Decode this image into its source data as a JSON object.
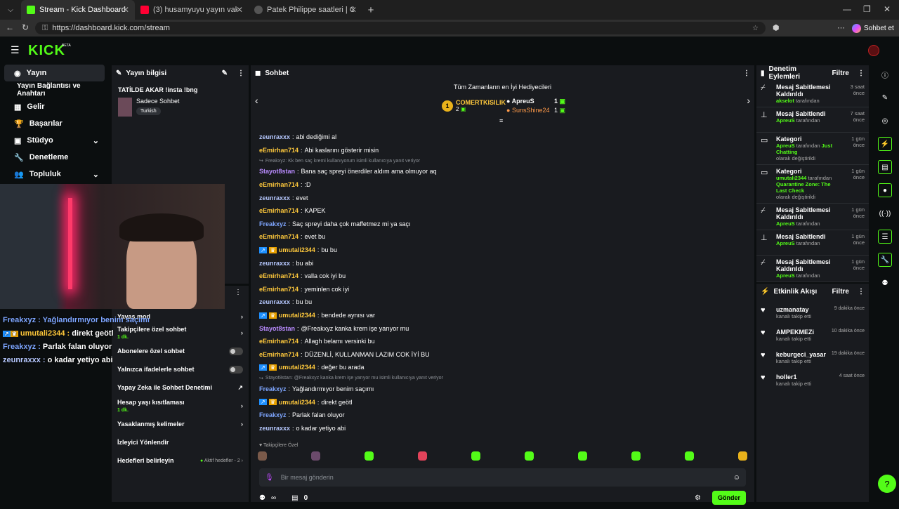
{
  "browser": {
    "tabs": [
      {
        "title": "Stream - Kick Dashboard",
        "active": true
      },
      {
        "title": "(3) husamyuyu yayın vakti 14 - You",
        "active": false
      },
      {
        "title": "Patek Philippe saatleri | Chrono24",
        "active": false
      }
    ],
    "url": "https://dashboard.kick.com/stream",
    "profile_label": "Sohbet et"
  },
  "brand": {
    "logo": "KICK",
    "beta": "BETA",
    "accent": "#53fc18"
  },
  "sidebar": {
    "items": [
      {
        "label": "Yayın",
        "icon": "broadcast-icon"
      },
      {
        "label": "Yayın Bağlantısı ve Anahtarı",
        "icon": ""
      },
      {
        "label": "Gelir",
        "icon": "money-icon"
      },
      {
        "label": "Başarılar",
        "icon": "trophy-icon"
      },
      {
        "label": "Stüdyo",
        "icon": "studio-icon"
      },
      {
        "label": "Denetleme",
        "icon": "wrench-icon"
      },
      {
        "label": "Topluluk",
        "icon": "community-icon"
      }
    ]
  },
  "stream_info": {
    "header": "Yayın bilgisi",
    "title": "TATİLDE AKAR !insta !bng",
    "category": "Sadece Sohbet",
    "tag": "Turkish"
  },
  "overlay_chat": [
    {
      "user": "Freakxyz",
      "text": "Yağlandırmıyor benim saçımı",
      "color": "#7ea6ff"
    },
    {
      "user": "umutali2344",
      "text": "direkt geötl",
      "color": "#ffc93c"
    },
    {
      "user": "Freakxyz",
      "text": "Parlak falan oluyor",
      "color": "#7ea6ff"
    },
    {
      "user": "zeunraxxx",
      "text": "o kadar yetiyo abi",
      "color": "#b6c8ff"
    }
  ],
  "chat_settings": {
    "rows": [
      {
        "label": "Yavaş mod",
        "sub": "",
        "control": "chevron"
      },
      {
        "label": "Takipçilere özel sohbet",
        "sub": "1 dk.",
        "control": "chevron"
      },
      {
        "label": "Abonelere özel sohbet",
        "sub": "",
        "control": "toggle"
      },
      {
        "label": "Yalnızca ifadelerle sohbet",
        "sub": "",
        "control": "toggle"
      },
      {
        "label": "Yapay Zeka ile Sohbet Denetimi",
        "sub": "",
        "control": "external"
      },
      {
        "label": "Hesap yaşı kısıtlaması",
        "sub": "1 dk.",
        "control": "chevron"
      },
      {
        "label": "Yasaklanmış kelimeler",
        "sub": "",
        "control": "chevron"
      },
      {
        "label": "İzleyici Yönlendir",
        "sub": "",
        "control": "none"
      },
      {
        "label": "Hedefleri belirleyin",
        "sub": "",
        "control": "chevron",
        "extra": "Aktif hedefler - 2"
      }
    ]
  },
  "chat": {
    "header": "Sohbet",
    "gifters_title": "Tüm Zamanların en İyi Hediyecileri",
    "gifters": [
      {
        "rank": "1",
        "name": "COMERTKISILIK",
        "count": "2"
      },
      {
        "rank": "",
        "name": "ApreuS",
        "count": "1"
      },
      {
        "rank": "",
        "name": "SunsShine24",
        "count": "1"
      }
    ],
    "messages": [
      {
        "user": "zeunraxxx",
        "text": "abi dediğimi al",
        "color": "#b6c8ff",
        "badges": false,
        "reply": ""
      },
      {
        "user": "eEmirhan714",
        "text": "Abi kaslarını gösterir misin",
        "color": "#ffc93c",
        "badges": false,
        "reply": ""
      },
      {
        "user": "Stayot8stan",
        "text": "Bana saç spreyi önerdiler aldım ama olmuyor aq",
        "color": "#b98bff",
        "badges": false,
        "reply": "Freakxyz: Kk ben saç kremi kullanıyorum isimli kullanıcıya yanıt veriyor"
      },
      {
        "user": "eEmirhan714",
        "text": ":D",
        "color": "#ffc93c",
        "badges": false,
        "reply": ""
      },
      {
        "user": "zeunraxxx",
        "text": "evet",
        "color": "#b6c8ff",
        "badges": false,
        "reply": ""
      },
      {
        "user": "eEmirhan714",
        "text": "KAPEK",
        "color": "#ffc93c",
        "badges": false,
        "reply": ""
      },
      {
        "user": "Freakxyz",
        "text": "Saç spreyi daha çok maffetmez mi ya saçı",
        "color": "#7ea6ff",
        "badges": false,
        "reply": ""
      },
      {
        "user": "eEmirhan714",
        "text": "evet bu",
        "color": "#ffc93c",
        "badges": false,
        "reply": ""
      },
      {
        "user": "umutali2344",
        "text": "bu bu",
        "color": "#ffc93c",
        "badges": true,
        "reply": ""
      },
      {
        "user": "zeunraxxx",
        "text": "bu abi",
        "color": "#b6c8ff",
        "badges": false,
        "reply": ""
      },
      {
        "user": "eEmirhan714",
        "text": "valla cok iyi bu",
        "color": "#ffc93c",
        "badges": false,
        "reply": ""
      },
      {
        "user": "eEmirhan714",
        "text": "yeminlen cok iyi",
        "color": "#ffc93c",
        "badges": false,
        "reply": ""
      },
      {
        "user": "zeunraxxx",
        "text": "bu bu",
        "color": "#b6c8ff",
        "badges": false,
        "reply": ""
      },
      {
        "user": "umutali2344",
        "text": "bendede aynısı var",
        "color": "#ffc93c",
        "badges": true,
        "reply": ""
      },
      {
        "user": "Stayot8stan",
        "text": "@Freakxyz kanka krem işe yarıyor mu",
        "color": "#b98bff",
        "badges": false,
        "reply": ""
      },
      {
        "user": "eEmirhan714",
        "text": "Allagh belamı versinki bu",
        "color": "#ffc93c",
        "badges": false,
        "reply": ""
      },
      {
        "user": "eEmirhan714",
        "text": "DÜZENLİ, KULLANMAN LAZIM COK İYİ BU",
        "color": "#ffc93c",
        "badges": false,
        "reply": ""
      },
      {
        "user": "umutali2344",
        "text": "değer bu arada",
        "color": "#ffc93c",
        "badges": true,
        "reply": ""
      },
      {
        "user": "Freakxyz",
        "text": "Yağlandırmıyor benim saçımı",
        "color": "#7ea6ff",
        "badges": false,
        "reply": "Stayot8stan: @Freakxyz kanka krem işe yarıyor mu isimli kullanıcıya yanıt veriyor"
      },
      {
        "user": "umutali2344",
        "text": "direkt geötl",
        "color": "#ffc93c",
        "badges": true,
        "reply": ""
      },
      {
        "user": "Freakxyz",
        "text": "Parlak falan oluyor",
        "color": "#7ea6ff",
        "badges": false,
        "reply": ""
      },
      {
        "user": "zeunraxxx",
        "text": "o kadar yetiyo abi",
        "color": "#b6c8ff",
        "badges": false,
        "reply": ""
      }
    ],
    "emote_label": "Takipçilere Özel",
    "input_placeholder": "Bir mesaj gönderin",
    "infinity": "∞",
    "count": "0",
    "send_label": "Gönder"
  },
  "mod_actions": {
    "header": "Denetim Eylemleri",
    "filter": "Filtre",
    "items": [
      {
        "title": "Mesaj Sabitlemesi Kaldırıldı",
        "user": "akselot",
        "suffix": "tarafından",
        "extra": "",
        "extra2": "",
        "time": "3 saat önce",
        "icon": "unpin-icon"
      },
      {
        "title": "Mesaj Sabitlendi",
        "user": "ApreuS",
        "suffix": "tarafından",
        "extra": "",
        "extra2": "",
        "time": "7 saat önce",
        "icon": "pin-icon"
      },
      {
        "title": "Kategori",
        "user": "ApreuS",
        "suffix": "tarafından",
        "extra": "Just Chatting",
        "extra2": "olarak değiştirildi",
        "time": "1 gün önce",
        "icon": "category-icon"
      },
      {
        "title": "Kategori",
        "user": "umutali2344",
        "suffix": "tarafından",
        "extra": "Quarantine Zone: The Last Check",
        "extra2": "olarak değiştirildi",
        "time": "1 gün önce",
        "icon": "category-icon"
      },
      {
        "title": "Mesaj Sabitlemesi Kaldırıldı",
        "user": "ApreuS",
        "suffix": "tarafından",
        "extra": "",
        "extra2": "",
        "time": "1 gün önce",
        "icon": "unpin-icon"
      },
      {
        "title": "Mesaj Sabitlendi",
        "user": "ApreuS",
        "suffix": "tarafından",
        "extra": "",
        "extra2": "",
        "time": "1 gün önce",
        "icon": "pin-icon"
      },
      {
        "title": "Mesaj Sabitlemesi Kaldırıldı",
        "user": "ApreuS",
        "suffix": "tarafından",
        "extra": "",
        "extra2": "",
        "time": "1 gün önce",
        "icon": "unpin-icon"
      }
    ]
  },
  "activity": {
    "header": "Etkinlik Akışı",
    "filter": "Filtre",
    "items": [
      {
        "user": "uzmanatay",
        "action": "kanalı takip etti",
        "time": "9 dakika önce"
      },
      {
        "user": "AMPEKMEZi",
        "action": "kanalı takip etti",
        "time": "10 dakika önce"
      },
      {
        "user": "keburgeci_yasar",
        "action": "kanalı takip etti",
        "time": "19 dakika önce"
      },
      {
        "user": "holler1",
        "action": "kanalı takip etti",
        "time": "4 saat önce"
      }
    ]
  }
}
